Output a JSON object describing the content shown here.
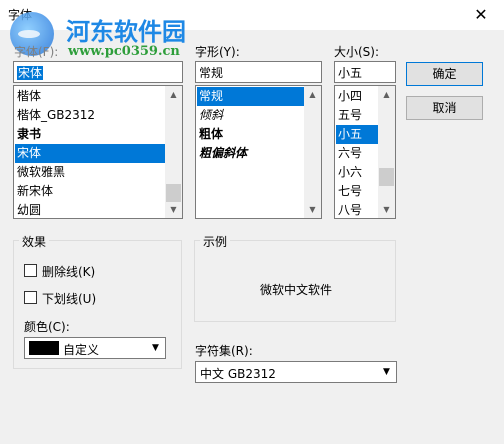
{
  "window": {
    "title": "字体",
    "close_glyph": "✕"
  },
  "watermark": {
    "main": "河东软件园",
    "url": "www.pc0359.cn"
  },
  "font": {
    "label": "字体(F):",
    "value": "宋体",
    "items": [
      "楷体",
      "楷体_GB2312",
      "隶书",
      "宋体",
      "微软雅黑",
      "新宋体",
      "幼圆"
    ],
    "selected_index": 3
  },
  "style": {
    "label": "字形(Y):",
    "value": "常规",
    "items": [
      "常规",
      "倾斜",
      "粗体",
      "粗偏斜体"
    ],
    "selected_index": 0
  },
  "size": {
    "label": "大小(S):",
    "value": "小五",
    "items": [
      "小四",
      "五号",
      "小五",
      "六号",
      "小六",
      "七号",
      "八号"
    ],
    "selected_index": 2
  },
  "buttons": {
    "ok": "确定",
    "cancel": "取消"
  },
  "effects": {
    "title": "效果",
    "strikeout": "删除线(K)",
    "underline": "下划线(U)",
    "color_label": "颜色(C):",
    "color_value": "自定义",
    "color_swatch": "#000000"
  },
  "sample": {
    "title": "示例",
    "text": "微软中文软件"
  },
  "charset": {
    "label": "字符集(R):",
    "value": "中文 GB2312"
  },
  "colors": {
    "selection": "#0078d7",
    "watermark_main": "#1e88e5",
    "watermark_url": "#2e9e3b"
  }
}
